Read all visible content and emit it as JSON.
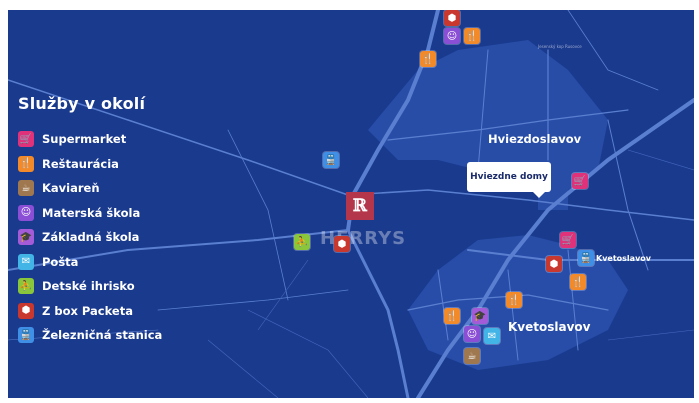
{
  "legend": {
    "title": "Služby v okolí",
    "items": [
      {
        "label": "Supermarket",
        "icon": "cart-icon",
        "glyph": "🛒",
        "color": "#e0327a"
      },
      {
        "label": "Reštaurácia",
        "icon": "fork-knife-icon",
        "glyph": "🍴",
        "color": "#f28a2a"
      },
      {
        "label": "Kaviareň",
        "icon": "coffee-cup-icon",
        "glyph": "☕",
        "color": "#a07850"
      },
      {
        "label": "Materská škola",
        "icon": "child-face-icon",
        "glyph": "☺",
        "color": "#8b4fd6"
      },
      {
        "label": "Základná škola",
        "icon": "graduation-cap-icon",
        "glyph": "🎓",
        "color": "#a45bd8"
      },
      {
        "label": "Pošta",
        "icon": "envelope-icon",
        "glyph": "✉",
        "color": "#42b4e6"
      },
      {
        "label": "Detské ihrisko",
        "icon": "slide-icon",
        "glyph": "⛹",
        "color": "#8ac63c"
      },
      {
        "label": "Z box Packeta",
        "icon": "package-icon",
        "glyph": "⬢",
        "color": "#c8382e"
      },
      {
        "label": "Železničná stanica",
        "icon": "train-icon",
        "glyph": "🚆",
        "color": "#3f8fe6"
      }
    ]
  },
  "places": {
    "hviezdoslavov": "Hviezdoslavov",
    "kvetoslavov_small": "Kvetoslavov",
    "kvetoslavov_large": "Kvetoslavov"
  },
  "callout": "Hviezdne domy",
  "brand": {
    "logo": "ℝ",
    "name": "HERRYS"
  }
}
